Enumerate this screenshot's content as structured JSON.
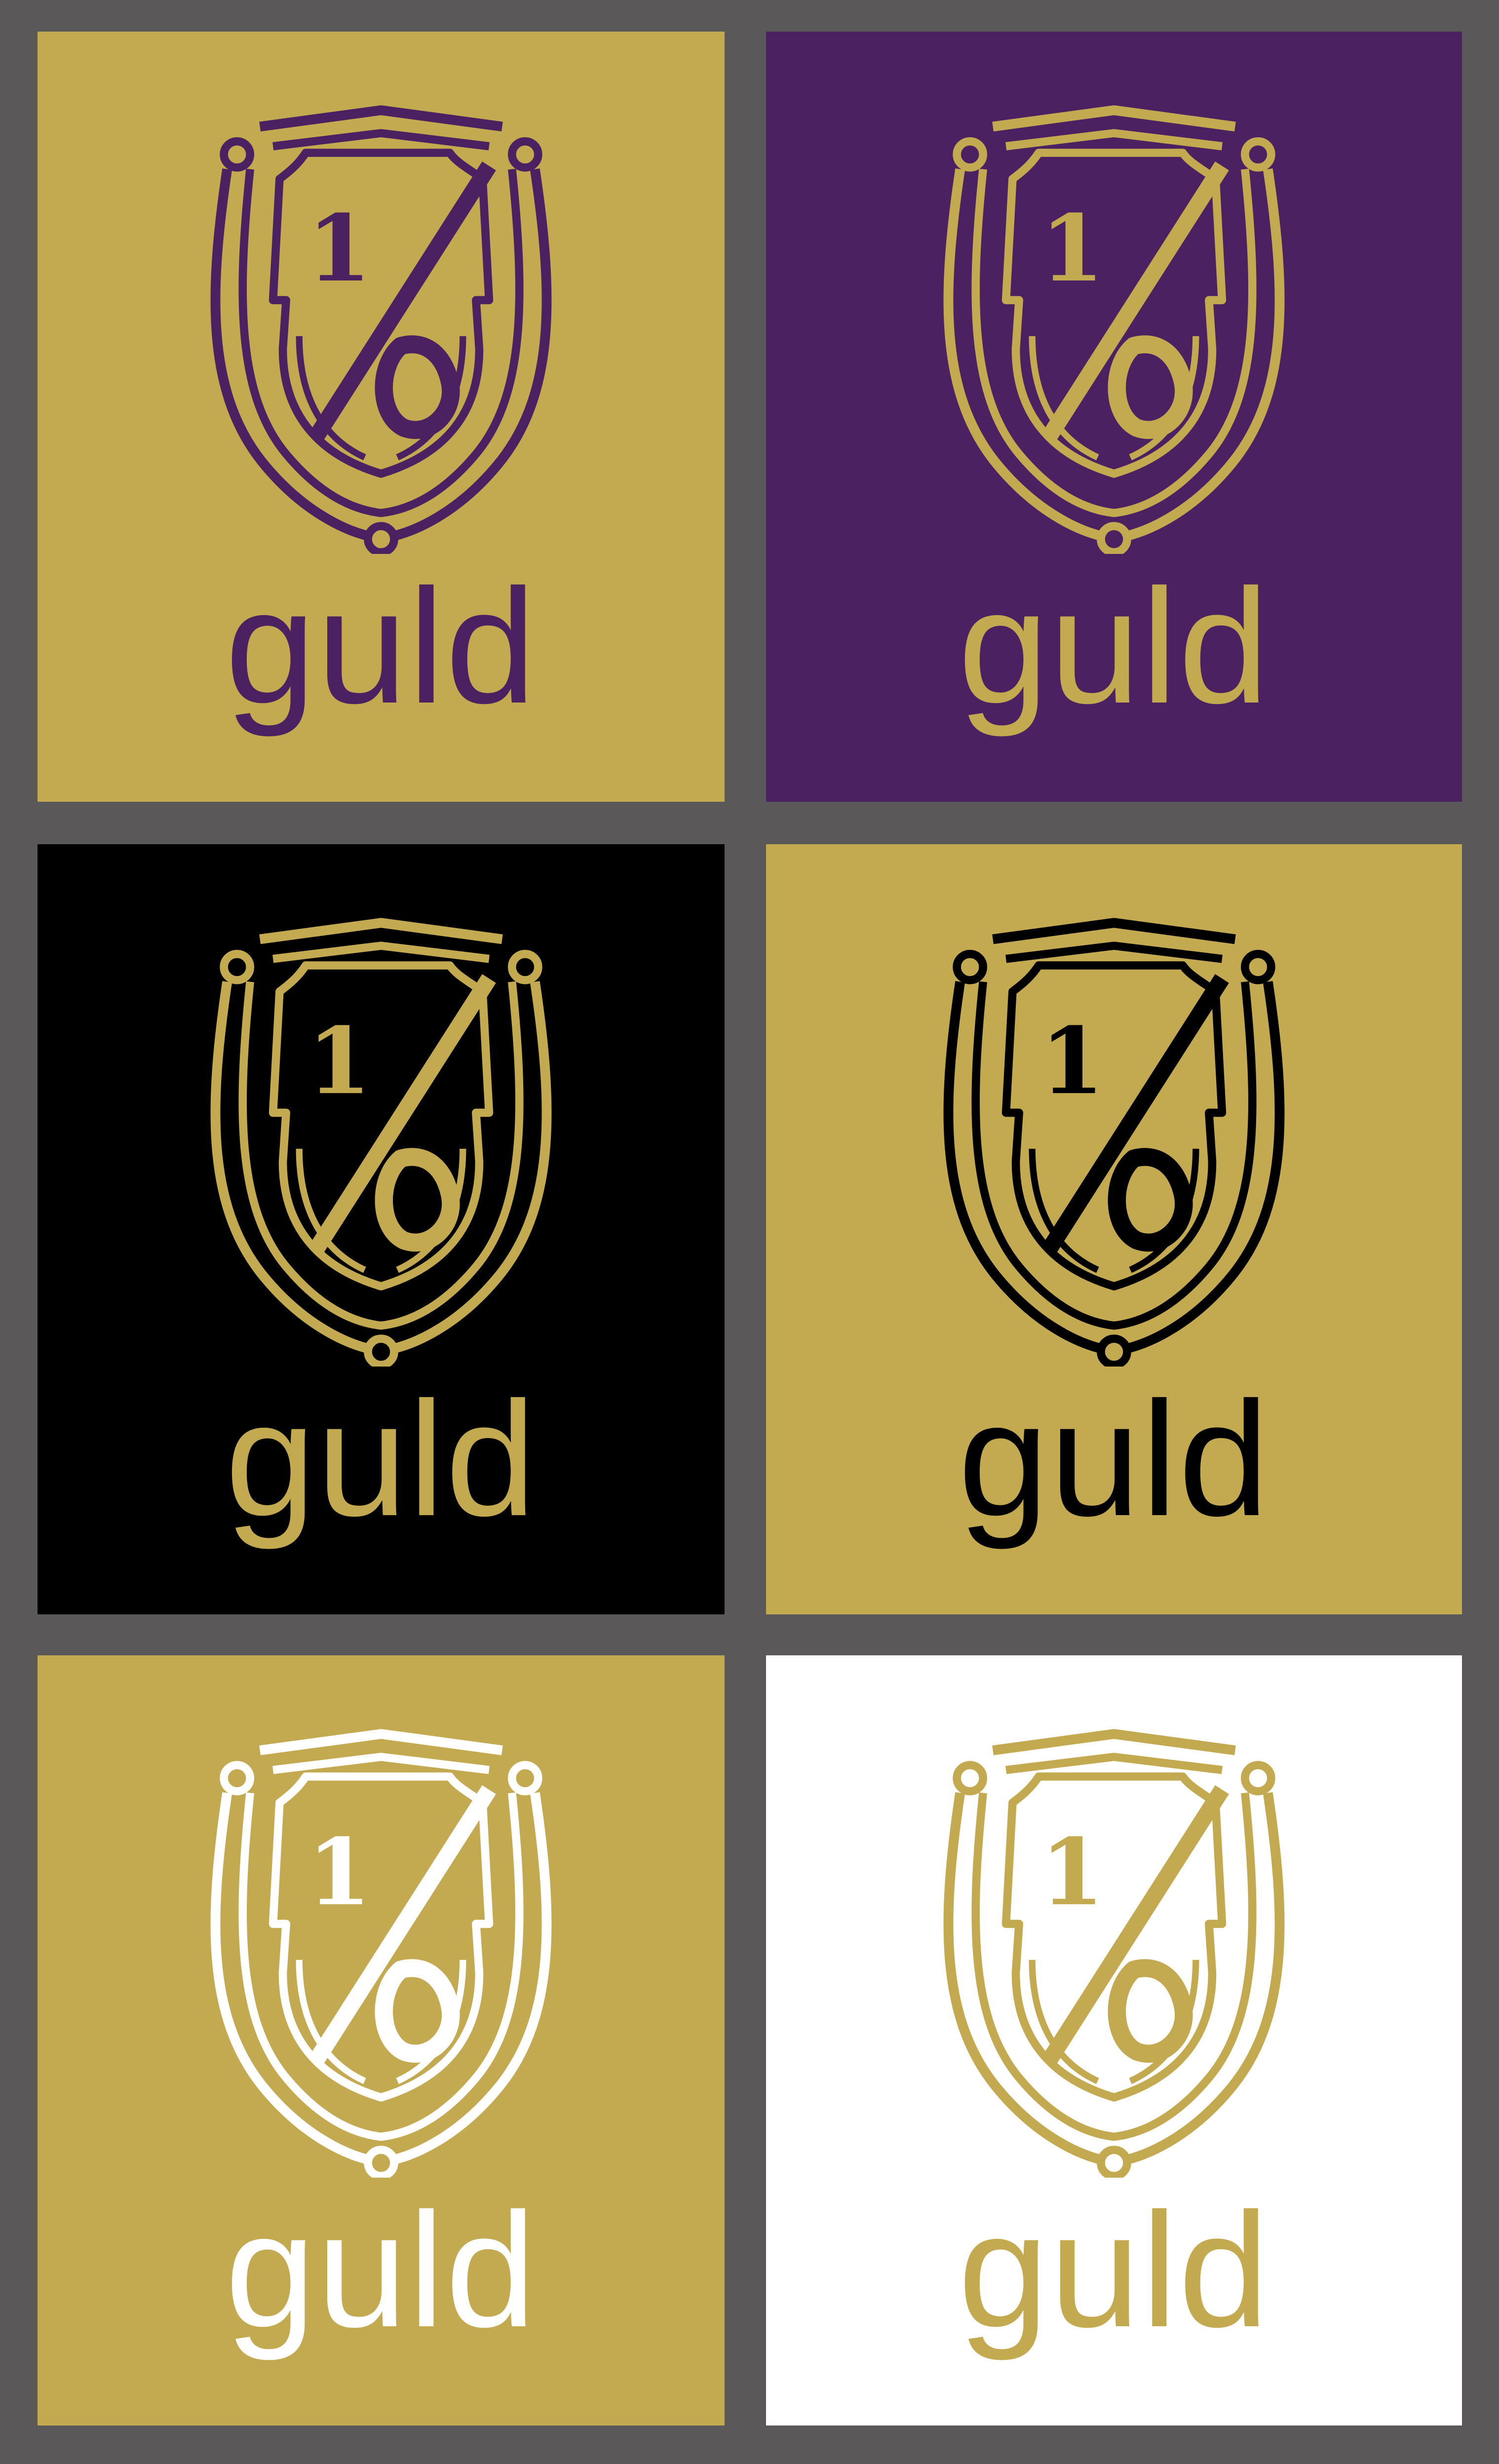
{
  "background": "#5a5859",
  "palette": {
    "gold": "#c3a94f",
    "purple": "#4b2161",
    "black": "#000000",
    "white": "#ffffff"
  },
  "crest_text": {
    "numerator": "1",
    "denominator": "0"
  },
  "tiles": [
    {
      "wordmark": "guld",
      "bg": "#c3a94f",
      "fg": "#4b2161"
    },
    {
      "wordmark": "guld",
      "bg": "#4b2161",
      "fg": "#c3a94f"
    },
    {
      "wordmark": "guld",
      "bg": "#000000",
      "fg": "#c3a94f"
    },
    {
      "wordmark": "guld",
      "bg": "#c3a94f",
      "fg": "#000000"
    },
    {
      "wordmark": "guld",
      "bg": "#c3a94f",
      "fg": "#ffffff"
    },
    {
      "wordmark": "guld",
      "bg": "#ffffff",
      "fg": "#c3a94f"
    }
  ]
}
